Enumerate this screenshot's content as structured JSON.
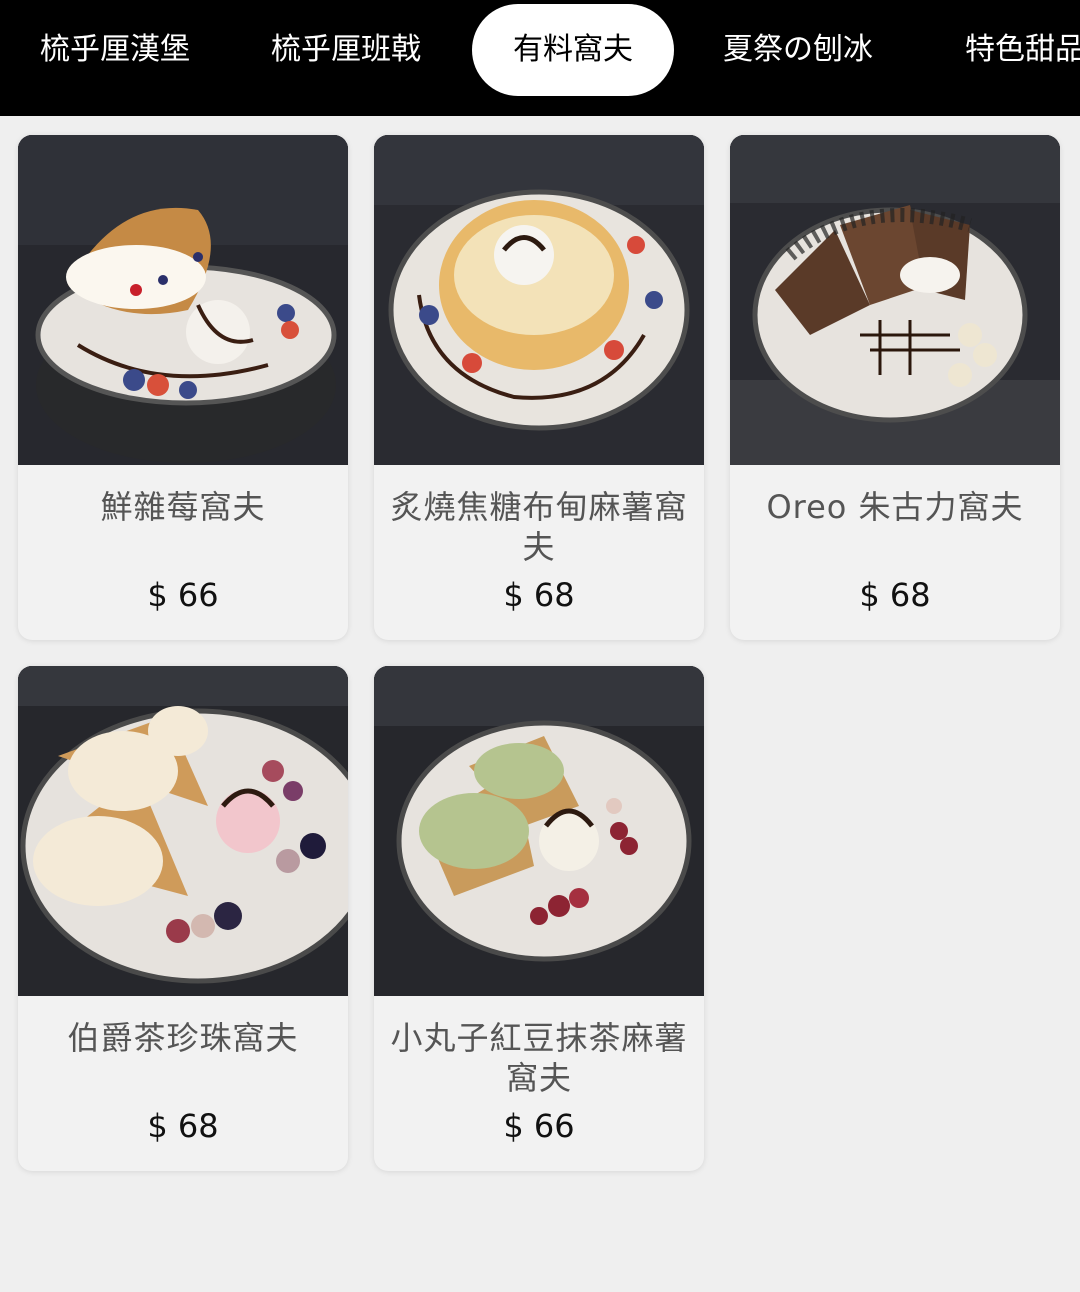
{
  "tabs": [
    {
      "label": "梳乎厘漢堡"
    },
    {
      "label": "梳乎厘班戟"
    },
    {
      "label": "有料窩夫",
      "active": true
    },
    {
      "label": "夏祭の刨冰"
    },
    {
      "label": "特色甜品"
    }
  ],
  "products": [
    {
      "name": "鮮雜莓窩夫",
      "price": "$ 66"
    },
    {
      "name": "炙燒焦糖布甸麻薯窩夫",
      "price": "$ 68"
    },
    {
      "name": "Oreo 朱古力窩夫",
      "price": "$ 68"
    },
    {
      "name": "伯爵茶珍珠窩夫",
      "price": "$ 68"
    },
    {
      "name": "小丸子紅豆抹茶麻薯窩夫",
      "price": "$ 66"
    }
  ],
  "colors": {
    "topbar": "#000000",
    "background": "#efefef",
    "card": "#f2f2f2",
    "active_tab": "#ffffff"
  }
}
